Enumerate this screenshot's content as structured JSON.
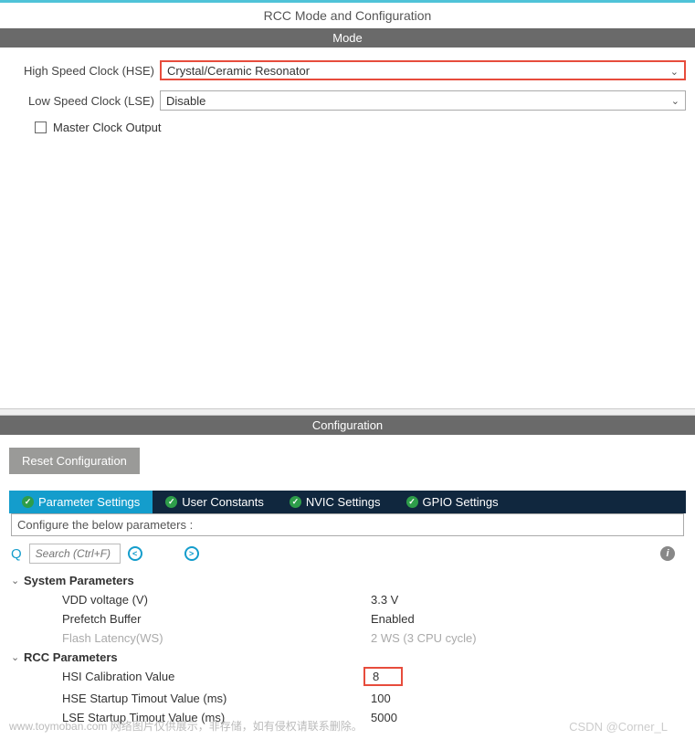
{
  "title": "RCC Mode and Configuration",
  "mode": {
    "header": "Mode",
    "hse_label": "High Speed Clock (HSE)",
    "hse_value": "Crystal/Ceramic Resonator",
    "lse_label": "Low Speed Clock (LSE)",
    "lse_value": "Disable",
    "master_clock_label": "Master Clock Output"
  },
  "config": {
    "header": "Configuration",
    "reset_btn": "Reset Configuration",
    "tabs": [
      "Parameter Settings",
      "User Constants",
      "NVIC Settings",
      "GPIO Settings"
    ],
    "subtitle": "Configure the below parameters :",
    "search_placeholder": "Search (Ctrl+F)",
    "nav_prev": "<",
    "nav_next": ">",
    "groups": [
      {
        "label": "System Parameters",
        "items": [
          {
            "key": "VDD voltage (V)",
            "value": "3.3 V",
            "disabled": false
          },
          {
            "key": "Prefetch Buffer",
            "value": "Enabled",
            "disabled": false
          },
          {
            "key": "Flash Latency(WS)",
            "value": "2 WS (3 CPU cycle)",
            "disabled": true
          }
        ]
      },
      {
        "label": "RCC Parameters",
        "items": [
          {
            "key": "HSI Calibration Value",
            "value": "8",
            "disabled": false,
            "highlight": true
          },
          {
            "key": "HSE Startup Timout Value (ms)",
            "value": "100",
            "disabled": false
          },
          {
            "key": "LSE Startup Timout Value (ms)",
            "value": "5000",
            "disabled": false
          }
        ]
      }
    ]
  },
  "watermark_left": "www.toymoban.com 网络图片仅供展示，非存储，如有侵权请联系删除。",
  "watermark_right": "CSDN @Corner_L"
}
